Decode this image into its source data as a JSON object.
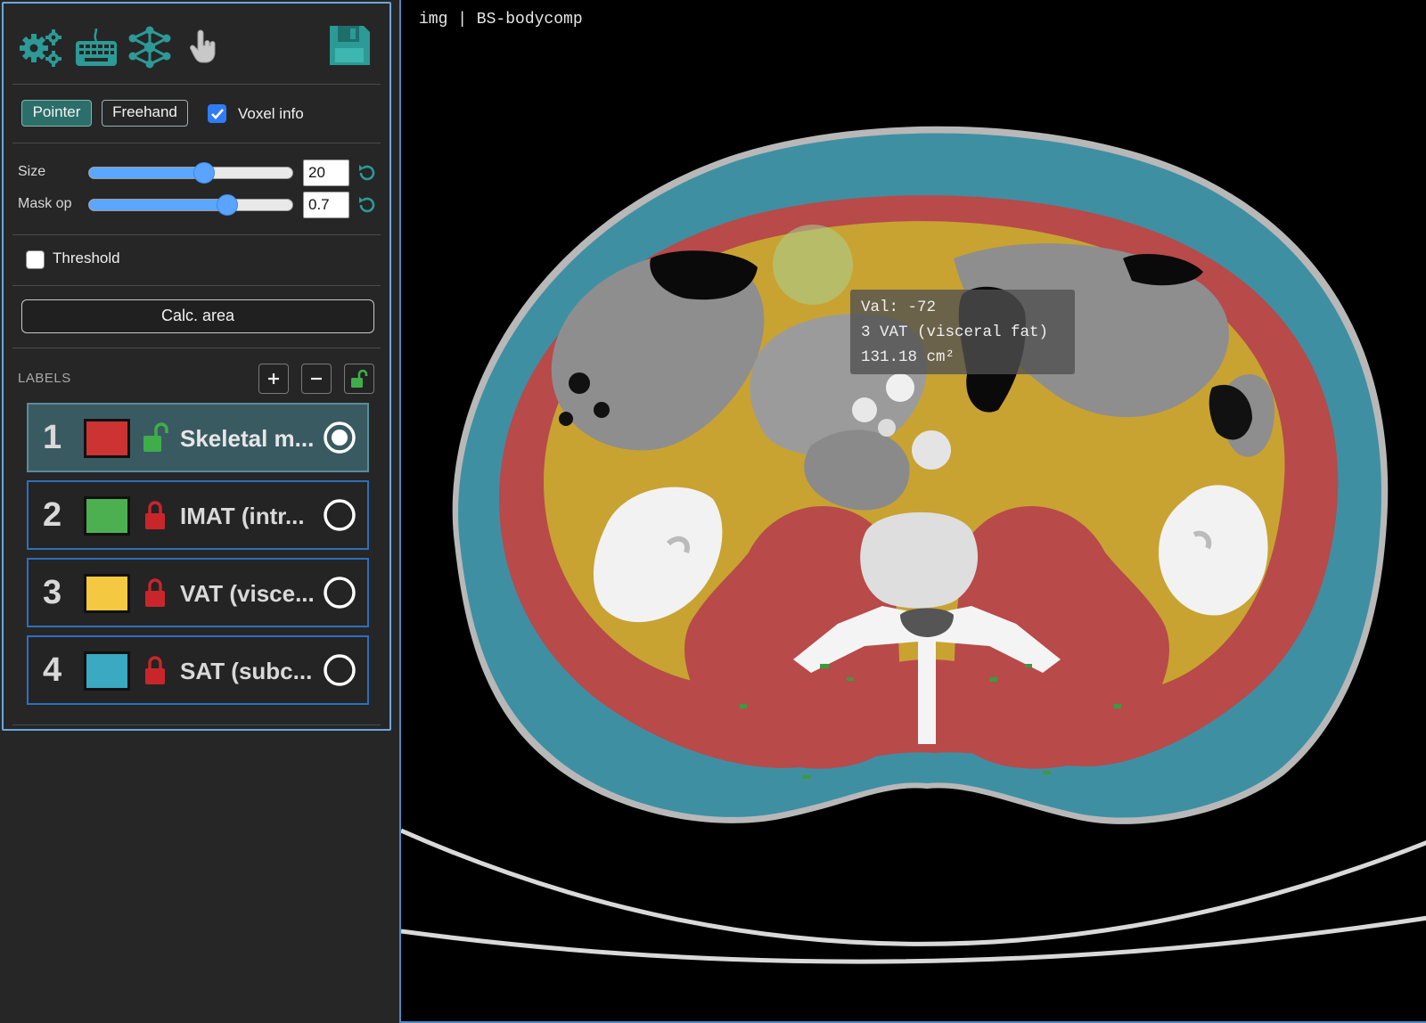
{
  "toolbar": {
    "icons": [
      "gears-icon",
      "keyboard-icon",
      "network-icon",
      "pointer-hand-icon",
      "save-icon"
    ]
  },
  "modes": {
    "pointer": "Pointer",
    "freehand": "Freehand",
    "active": "pointer"
  },
  "voxel_info": {
    "label": "Voxel info",
    "checked": true
  },
  "sliders": {
    "size": {
      "label": "Size",
      "value": "20",
      "fraction": 0.56
    },
    "mask_op": {
      "label": "Mask op",
      "value": "0.7",
      "fraction": 0.67
    }
  },
  "threshold": {
    "label": "Threshold",
    "checked": false
  },
  "calc_area": "Calc. area",
  "labels_section": {
    "title": "LABELS",
    "items": [
      {
        "num": "1",
        "name": "Skeletal m...",
        "color": "#cc3333",
        "locked": false,
        "selected": true
      },
      {
        "num": "2",
        "name": "IMAT (intr...",
        "color": "#4cb050",
        "locked": true,
        "selected": false
      },
      {
        "num": "3",
        "name": "VAT (visce...",
        "color": "#f5c842",
        "locked": true,
        "selected": false
      },
      {
        "num": "4",
        "name": "SAT (subc...",
        "color": "#3aa9c1",
        "locked": true,
        "selected": false
      }
    ]
  },
  "viewer": {
    "title": "img | BS-bodycomp",
    "tooltip": {
      "value_line": "Val: -72",
      "label_line": "3 VAT (visceral fat)",
      "area_line": "131.18 cm²"
    }
  },
  "colors": {
    "accent": "#2c6f6a",
    "border": "#6aa8dc",
    "skeletal": "#cc3333",
    "imat": "#4cb050",
    "vat": "#f5c842",
    "sat": "#3aa9c1"
  }
}
